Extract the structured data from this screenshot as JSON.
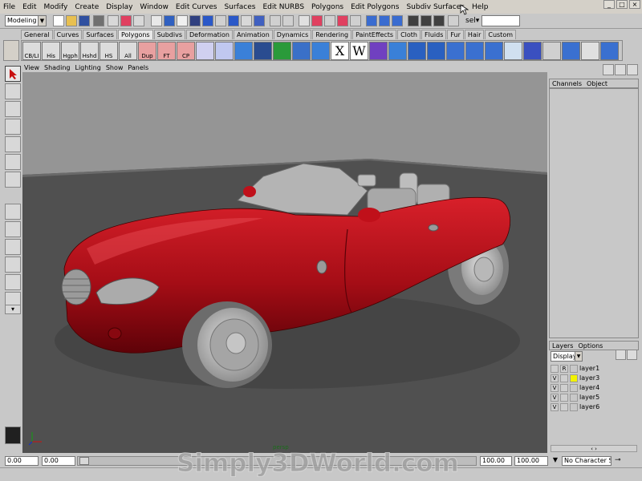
{
  "menubar": {
    "items": [
      "File",
      "Edit",
      "Modify",
      "Create",
      "Display",
      "Window",
      "Edit Curves",
      "Surfaces",
      "Edit NURBS",
      "Polygons",
      "Edit Polygons",
      "Subdiv Surfaces",
      "Help"
    ]
  },
  "statusline": {
    "mode": "Modeling",
    "selection_label": "sel",
    "selection_arrow": "▾",
    "selection_value": ""
  },
  "shelf": {
    "tabs": [
      "General",
      "Curves",
      "Surfaces",
      "Polygons",
      "Subdivs",
      "Deformation",
      "Animation",
      "Dynamics",
      "Rendering",
      "PaintEffects",
      "Cloth",
      "Fluids",
      "Fur",
      "Hair",
      "Custom"
    ],
    "active_tab": "Polygons",
    "icons": [
      {
        "label": "CB/LI",
        "icon": "cb-li-icon"
      },
      {
        "label": "His",
        "icon": "history-icon"
      },
      {
        "label": "Hgph",
        "icon": "hypergraph-icon"
      },
      {
        "label": "Hshd",
        "icon": "hypershade-icon"
      },
      {
        "label": "HS",
        "icon": "hs-icon"
      },
      {
        "label": "All",
        "icon": "all-icon"
      },
      {
        "label": "Dup",
        "icon": "duplicate-icon"
      },
      {
        "label": "FT",
        "icon": "freeze-transform-icon"
      },
      {
        "label": "CP",
        "icon": "center-pivot-icon"
      }
    ],
    "glyph_x": "X",
    "glyph_w": "W"
  },
  "panel_menu": [
    "View",
    "Shading",
    "Lighting",
    "Show",
    "Panels"
  ],
  "viewport": {
    "camera": "persp"
  },
  "channel_box": {
    "tabs": [
      "Channels",
      "Object"
    ]
  },
  "layers": {
    "tabs": [
      "Layers",
      "Options"
    ],
    "display_select": "Display",
    "rows": [
      {
        "vis": "",
        "type": "R",
        "name": "layer1",
        "color": ""
      },
      {
        "vis": "V",
        "type": "",
        "name": "layer3",
        "color": "#f2f200"
      },
      {
        "vis": "V",
        "type": "",
        "name": "layer4",
        "color": ""
      },
      {
        "vis": "V",
        "type": "",
        "name": "layer5",
        "color": ""
      },
      {
        "vis": "V",
        "type": "",
        "name": "layer6",
        "color": ""
      }
    ],
    "scroll_arrows": "‹ ›"
  },
  "range": {
    "start_time": "0.00",
    "start_range": "0.00",
    "end_range": "100.00",
    "end_time": "100.00",
    "character_set": "No Character Set"
  },
  "watermark": "Simply3DWorld.com",
  "colors": {
    "car_body": "#b0101a",
    "background": "#959595",
    "floor": "#505050"
  }
}
